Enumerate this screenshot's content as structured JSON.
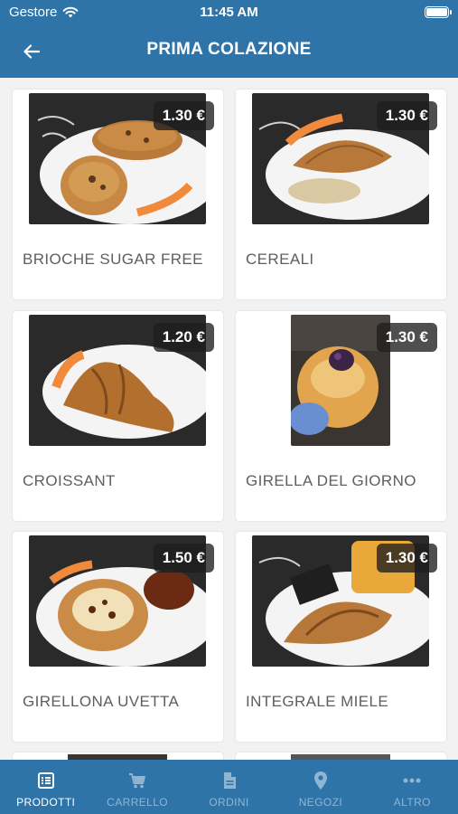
{
  "status_bar": {
    "carrier": "Gestore",
    "time": "11:45 AM"
  },
  "header": {
    "title": "PRIMA COLAZIONE",
    "back_icon": "arrow-left-icon"
  },
  "products": [
    {
      "name": "BRIOCHE SUGAR FREE",
      "price": "1.30 €"
    },
    {
      "name": "CEREALI",
      "price": "1.30 €"
    },
    {
      "name": "CROISSANT",
      "price": "1.20 €"
    },
    {
      "name": "GIRELLA DEL GIORNO",
      "price": "1.30 €"
    },
    {
      "name": "GIRELLONA UVETTA",
      "price": "1.50 €"
    },
    {
      "name": "INTEGRALE MIELE",
      "price": "1.30 €"
    }
  ],
  "tabs": [
    {
      "label": "PRODOTTI",
      "icon": "list-icon",
      "active": true
    },
    {
      "label": "CARRELLO",
      "icon": "cart-icon",
      "active": false
    },
    {
      "label": "ORDINI",
      "icon": "document-icon",
      "active": false
    },
    {
      "label": "NEGOZI",
      "icon": "location-pin-icon",
      "active": false
    },
    {
      "label": "ALTRO",
      "icon": "more-icon",
      "active": false
    }
  ],
  "colors": {
    "primary": "#2f74a8",
    "tab_inactive": "#8fb5d4",
    "background": "#f2f2f2"
  }
}
